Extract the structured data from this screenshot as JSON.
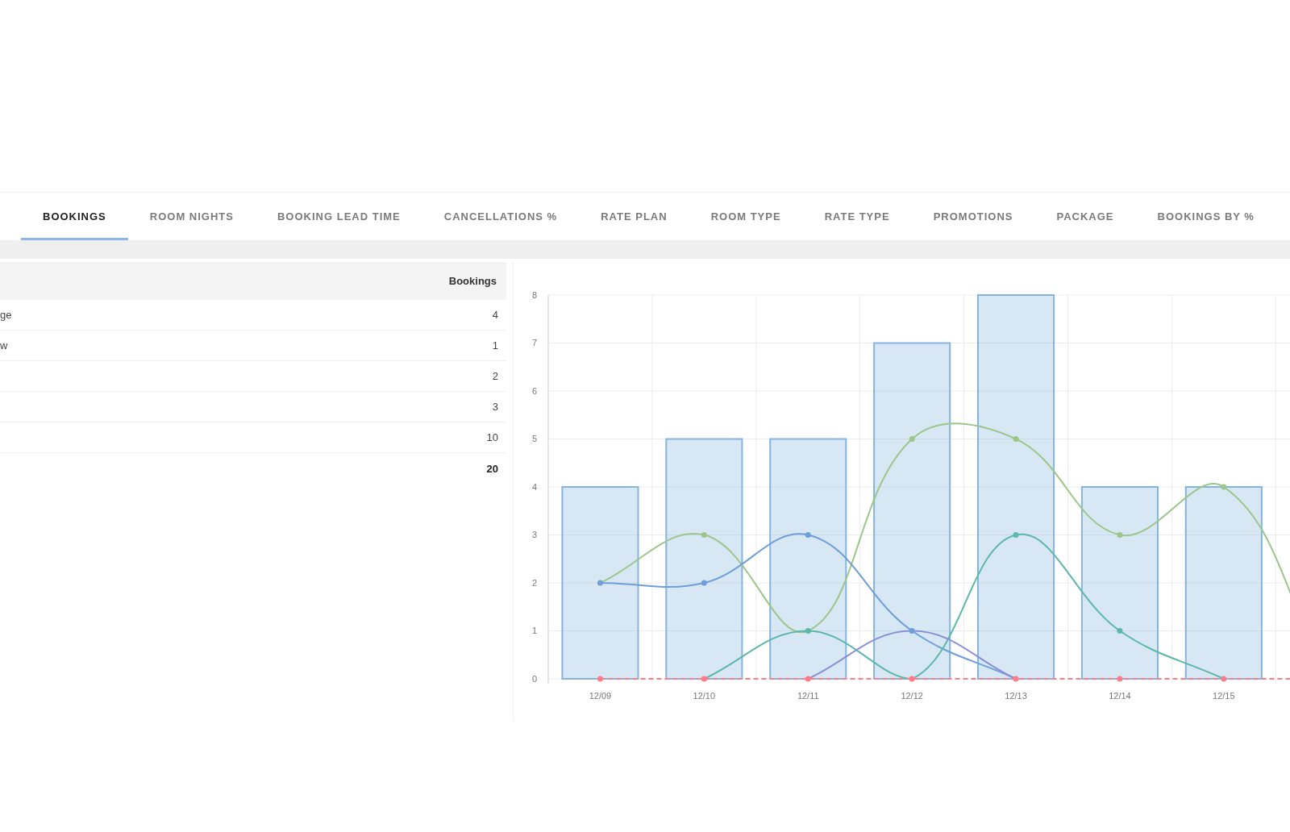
{
  "tabs": [
    {
      "label": "BOOKINGS",
      "selected": true
    },
    {
      "label": "ROOM NIGHTS",
      "selected": false
    },
    {
      "label": "BOOKING LEAD TIME",
      "selected": false
    },
    {
      "label": "CANCELLATIONS %",
      "selected": false
    },
    {
      "label": "RATE PLAN",
      "selected": false
    },
    {
      "label": "ROOM TYPE",
      "selected": false
    },
    {
      "label": "RATE TYPE",
      "selected": false
    },
    {
      "label": "PROMOTIONS",
      "selected": false
    },
    {
      "label": "PACKAGE",
      "selected": false
    },
    {
      "label": "BOOKINGS BY %",
      "selected": false
    }
  ],
  "table": {
    "columns": [
      "Bookings"
    ],
    "rows": [
      {
        "kind": "item",
        "label": "ge",
        "value": "4"
      },
      {
        "kind": "item",
        "label": "w",
        "value": "1"
      },
      {
        "kind": "item",
        "value": "2"
      },
      {
        "kind": "item",
        "value": "3"
      },
      {
        "kind": "item",
        "value": "10"
      },
      {
        "kind": "total",
        "value": "20"
      }
    ]
  },
  "chart": {
    "chart_data": {
      "type": "bar",
      "categories": [
        "12/09",
        "12/10",
        "12/11",
        "12/12",
        "12/13",
        "12/14",
        "12/15",
        null
      ],
      "ylim": [
        0,
        8
      ],
      "yticks": [
        0,
        1,
        2,
        3,
        4,
        5,
        6,
        7,
        8
      ],
      "grid": true,
      "series": [
        {
          "color": "#86b4dc",
          "values": [
            4,
            5,
            5,
            7,
            8,
            4,
            4,
            null
          ]
        },
        {
          "type": "line",
          "marker": "circle",
          "color": "#9cc68a",
          "values": [
            2,
            3,
            1,
            5,
            5,
            3,
            4,
            0
          ]
        },
        {
          "type": "line",
          "marker": "circle",
          "color": "#6f9fd8",
          "values": [
            2,
            2,
            3,
            1,
            0,
            null,
            null,
            null
          ]
        },
        {
          "type": "line",
          "marker": "circle",
          "color": "#5cb8a8",
          "values": [
            null,
            0,
            1,
            0,
            3,
            1,
            0,
            null
          ]
        },
        {
          "type": "line",
          "color": "#8a8fd6",
          "values": [
            null,
            null,
            0,
            1,
            0,
            null,
            null,
            null
          ]
        },
        {
          "type": "line",
          "marker": "circle",
          "color": "#ff7a8a",
          "line_style": "dashed",
          "values": [
            0,
            0,
            0,
            0,
            0,
            0,
            0,
            0
          ]
        }
      ]
    }
  }
}
